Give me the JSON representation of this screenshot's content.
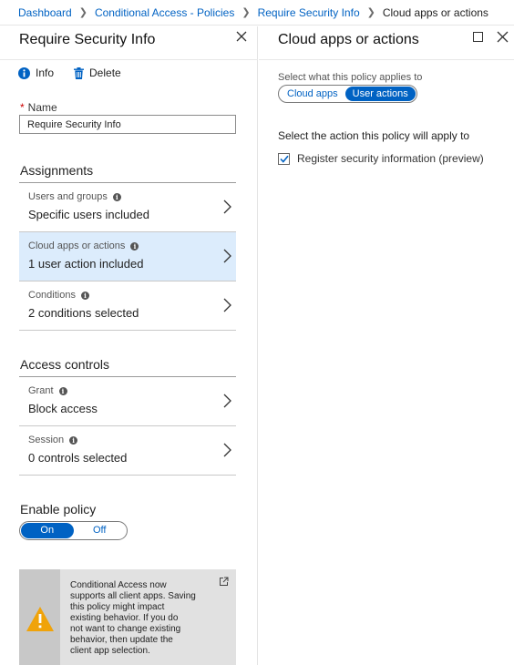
{
  "breadcrumb": {
    "items": [
      "Dashboard",
      "Conditional Access - Policies",
      "Require Security Info"
    ],
    "current": "Cloud apps or actions"
  },
  "left_blade": {
    "title": "Require Security Info",
    "toolbar": {
      "info_label": "Info",
      "delete_label": "Delete"
    },
    "name_field": {
      "label": "Name",
      "value": "Require Security Info"
    },
    "assignments": {
      "heading": "Assignments",
      "rows": [
        {
          "label": "Users and groups",
          "value": "Specific users included"
        },
        {
          "label": "Cloud apps or actions",
          "value": "1 user action included"
        },
        {
          "label": "Conditions",
          "value": "2 conditions selected"
        }
      ]
    },
    "access_controls": {
      "heading": "Access controls",
      "rows": [
        {
          "label": "Grant",
          "value": "Block access"
        },
        {
          "label": "Session",
          "value": "0 controls selected"
        }
      ]
    },
    "enable_policy": {
      "heading": "Enable policy",
      "on_label": "On",
      "off_label": "Off",
      "selected": "On"
    },
    "warning": {
      "lines": [
        "Conditional Access now",
        "supports all client apps. Saving",
        "this policy might impact",
        "existing behavior. If you do",
        "not want to change existing",
        "behavior, then update the",
        "client app selection."
      ]
    }
  },
  "right_blade": {
    "title": "Cloud apps or actions",
    "applies_label": "Select what this policy applies to",
    "segments": [
      "Cloud apps",
      "User actions"
    ],
    "selected_segment": "User actions",
    "action_label": "Select the action this policy will apply to",
    "checkbox": {
      "label": "Register security information (preview)",
      "checked": true
    }
  },
  "colors": {
    "accent": "#0062c3",
    "selected_row": "#dcecfc",
    "warning_orange": "#f0a30a",
    "warning_bg": "#e1e1e1"
  },
  "icons": [
    "info-icon",
    "trash-icon",
    "close-icon",
    "maximize-icon",
    "chevron-right-icon",
    "warning-icon",
    "external-link-icon",
    "checkmark-icon"
  ]
}
